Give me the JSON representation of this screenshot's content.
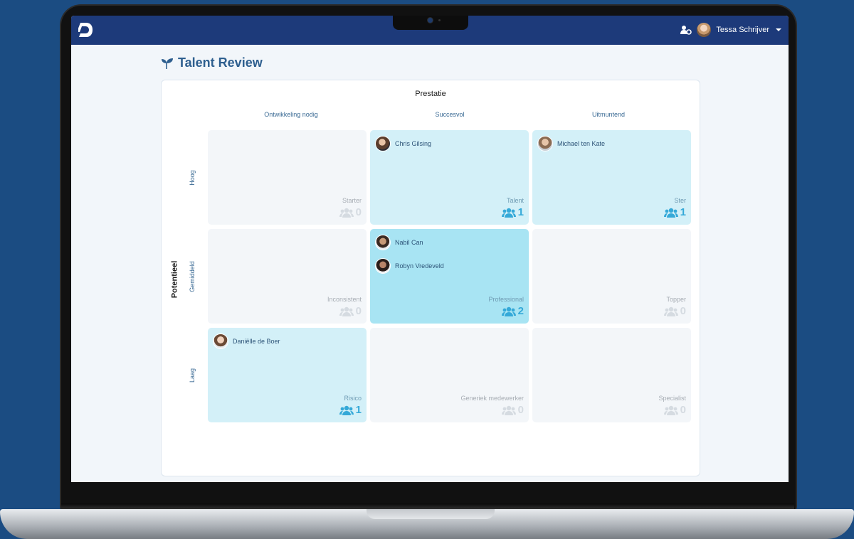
{
  "header": {
    "user_name": "Tessa Schrijver",
    "brand_color": "#1d3a7a"
  },
  "page": {
    "title": "Talent Review"
  },
  "grid": {
    "x_axis_title": "Prestatie",
    "y_axis_title": "Potentieel",
    "columns": [
      "Ontwikkeling nodig",
      "Succesvol",
      "Uitmuntend"
    ],
    "rows": [
      "Hoog",
      "Gemiddeld",
      "Laag"
    ],
    "cells": [
      {
        "row": 0,
        "col": 0,
        "label": "Starter",
        "count": "0",
        "people": []
      },
      {
        "row": 0,
        "col": 1,
        "label": "Talent",
        "count": "1",
        "people": [
          "Chris Gilsing"
        ]
      },
      {
        "row": 0,
        "col": 2,
        "label": "Ster",
        "count": "1",
        "people": [
          "Michael ten Kate"
        ]
      },
      {
        "row": 1,
        "col": 0,
        "label": "Inconsistent",
        "count": "0",
        "people": []
      },
      {
        "row": 1,
        "col": 1,
        "label": "Professional",
        "count": "2",
        "people": [
          "Nabil Can",
          "Robyn Vredeveld"
        ]
      },
      {
        "row": 1,
        "col": 2,
        "label": "Topper",
        "count": "0",
        "people": []
      },
      {
        "row": 2,
        "col": 0,
        "label": "Risico",
        "count": "1",
        "people": [
          "Daniëlle de Boer"
        ]
      },
      {
        "row": 2,
        "col": 1,
        "label": "Generiek medewerker",
        "count": "0",
        "people": []
      },
      {
        "row": 2,
        "col": 2,
        "label": "Specialist",
        "count": "0",
        "people": []
      }
    ]
  },
  "colors": {
    "accent": "#35a9d8",
    "cell_light": "#d3f0f8",
    "cell_mid": "#a8e4f3",
    "cell_empty": "#f3f6f9",
    "title": "#2e5f8f"
  }
}
